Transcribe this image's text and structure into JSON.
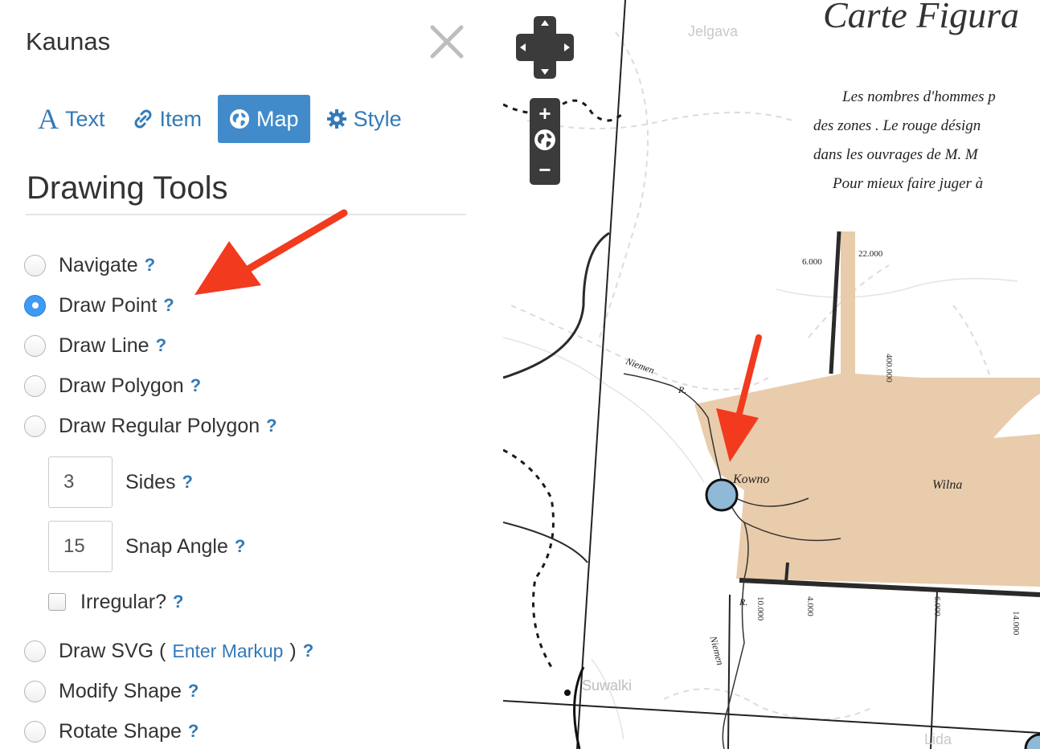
{
  "panel": {
    "title": "Kaunas",
    "tabs": [
      {
        "label": "Text",
        "icon": "text-icon"
      },
      {
        "label": "Item",
        "icon": "link-icon"
      },
      {
        "label": "Map",
        "icon": "globe-icon",
        "active": true
      },
      {
        "label": "Style",
        "icon": "gear-icon"
      }
    ],
    "section_title": "Drawing Tools",
    "help": "?",
    "tools": {
      "navigate": "Navigate",
      "draw_point": "Draw Point",
      "draw_line": "Draw Line",
      "draw_polygon": "Draw Polygon",
      "draw_regular_polygon": "Draw Regular Polygon",
      "draw_svg_prefix": "Draw SVG (",
      "draw_svg_link": "Enter Markup",
      "draw_svg_suffix": ")",
      "modify_shape": "Modify Shape",
      "rotate_shape": "Rotate Shape"
    },
    "selected_tool": "Draw Point",
    "regular_polygon": {
      "sides_value": "3",
      "sides_label": "Sides",
      "snap_angle_value": "15",
      "snap_angle_label": "Snap Angle",
      "irregular_label": "Irregular?",
      "irregular_checked": false
    }
  },
  "map": {
    "zoom_in": "+",
    "zoom_out": "−",
    "title_fragment": "Carte Figura",
    "handwriting": [
      "Les nombres d'hommes p",
      "des zones . Le rouge désign",
      "dans les ouvrages de M. M",
      "Pour mieux faire juger à"
    ],
    "labels": {
      "jelgava": "Jelgava",
      "suwalki": "Suwalki",
      "lida": "Lida",
      "kowno": "Kowno",
      "wilna": "Wilna",
      "niemen_top": "Niemen",
      "niemen_r": "R.",
      "niemen_bottom": "Niemen",
      "niemen_bottom_r": "R."
    },
    "numbers": {
      "n6000": "6.000",
      "n22000": "22.000",
      "n400000": "400.000",
      "n10000": "10.000",
      "n4000": "4.000",
      "n6000b": "6.000",
      "n14000": "14.000"
    },
    "colors": {
      "army_band": "#e8c9a6",
      "point_fill": "#8fb9d6",
      "annotation_arrow": "#f23a1f",
      "map_control": "#3b3b3b"
    }
  }
}
